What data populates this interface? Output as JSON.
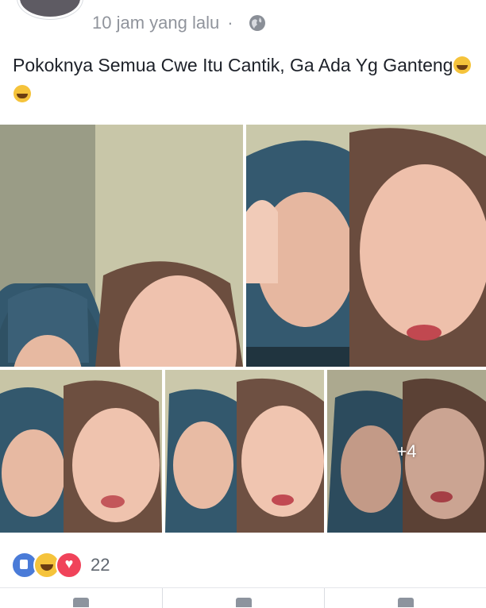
{
  "post": {
    "author": "",
    "time": "10 jam yang lalu",
    "separator": "·",
    "privacy_icon": "globe-icon",
    "text": "Pokoknya Semua Cwe Itu Cantik, Ga Ada Yg Ganteng",
    "emojis": [
      "laughing-crying-emoji",
      "laughing-crying-emoji"
    ]
  },
  "photos": {
    "more_label": "+4"
  },
  "reactions": {
    "icons": [
      "like-icon",
      "haha-icon",
      "love-icon"
    ],
    "count": "22"
  },
  "actions": {
    "icons": [
      "like-button-icon",
      "comment-button-icon",
      "share-button-icon"
    ]
  },
  "colors": {
    "like": "#4a7bd8",
    "haha": "#f5c33b",
    "love": "#f0435a",
    "meta_text": "#90949c"
  }
}
